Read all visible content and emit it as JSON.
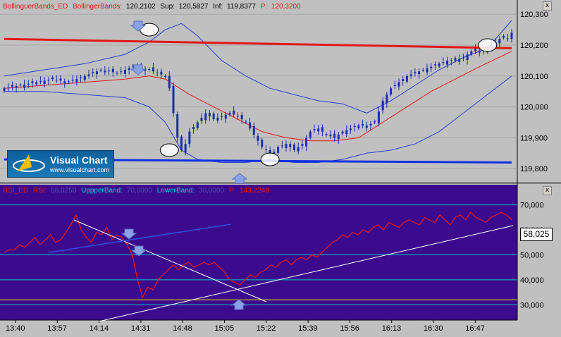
{
  "colors": {
    "price_bg": "#c0c0c0",
    "rsi_bg": "#3c0a8c",
    "candles": "#1a2ea8",
    "upper_band": "#2a3fd0",
    "mid_band": "#e01818",
    "support": "#e01818",
    "inferior": "#1030e0",
    "rsi_line": "#e01818",
    "rsi_levels": "#00c8c8",
    "rsi_band": "#e8e800",
    "trend_lines": "#ffffff"
  },
  "header": {
    "name": "BollinguerBands_ED",
    "band_label": "BollingerBands:",
    "band_value": "120,2102",
    "sup_label": "Sup:",
    "sup_value": "120,5827",
    "inf_label": "Inf:",
    "inf_value": "119,8377",
    "p_label": "P:",
    "p_value": "120,3200"
  },
  "rsi_header": {
    "name": "RSI_ED",
    "rsi_label": "RSI:",
    "rsi_value": "58,0250",
    "upper_label": "UppperBand:",
    "upper_value": "70,0000",
    "lower_label": "LowerBand:",
    "lower_value": "30,0000",
    "p_label": "P:",
    "p_value": "143,2248"
  },
  "logo": {
    "title": "Visual Chart",
    "url": "www.visualchart.com"
  },
  "buttons": {
    "close": "x"
  },
  "rsi_current_label": "58,025",
  "chart_data": [
    {
      "type": "candlestick",
      "panel": "price",
      "y_ticks": [
        "120,300",
        "120,200",
        "120,100",
        "120,000",
        "119,900",
        "119,800"
      ],
      "ylim": [
        119.78,
        120.305
      ],
      "x_ticks": [
        "13:40",
        "13:57",
        "14:14",
        "14:31",
        "14:48",
        "15:05",
        "15:22",
        "15:39",
        "15:56",
        "16:13",
        "16:30",
        "16:47"
      ],
      "close_series": [
        [
          0,
          120.06
        ],
        [
          4,
          120.07
        ],
        [
          8,
          120.08
        ],
        [
          12,
          120.09
        ],
        [
          16,
          120.08
        ],
        [
          20,
          120.1
        ],
        [
          24,
          120.12
        ],
        [
          28,
          120.11
        ],
        [
          32,
          120.13
        ],
        [
          36,
          120.12
        ],
        [
          40,
          120.1
        ],
        [
          41,
          120.06
        ],
        [
          42,
          119.98
        ],
        [
          43,
          119.9
        ],
        [
          44,
          119.86
        ],
        [
          45,
          119.88
        ],
        [
          46,
          119.92
        ],
        [
          48,
          119.95
        ],
        [
          50,
          119.98
        ],
        [
          52,
          119.96
        ],
        [
          54,
          119.97
        ],
        [
          56,
          119.98
        ],
        [
          58,
          119.97
        ],
        [
          60,
          119.95
        ],
        [
          62,
          119.91
        ],
        [
          64,
          119.87
        ],
        [
          65,
          119.86
        ],
        [
          66,
          119.84
        ],
        [
          68,
          119.87
        ],
        [
          70,
          119.88
        ],
        [
          72,
          119.86
        ],
        [
          74,
          119.88
        ],
        [
          76,
          119.92
        ],
        [
          78,
          119.93
        ],
        [
          80,
          119.91
        ],
        [
          82,
          119.9
        ],
        [
          84,
          119.92
        ],
        [
          86,
          119.93
        ],
        [
          88,
          119.94
        ],
        [
          90,
          119.94
        ],
        [
          92,
          119.95
        ],
        [
          94,
          120.02
        ],
        [
          96,
          120.06
        ],
        [
          98,
          120.08
        ],
        [
          100,
          120.1
        ],
        [
          102,
          120.11
        ],
        [
          104,
          120.12
        ],
        [
          106,
          120.13
        ],
        [
          108,
          120.14
        ],
        [
          110,
          120.15
        ],
        [
          112,
          120.15
        ],
        [
          114,
          120.16
        ],
        [
          116,
          120.18
        ],
        [
          118,
          120.18
        ],
        [
          120,
          120.19
        ],
        [
          122,
          120.21
        ],
        [
          124,
          120.23
        ],
        [
          125,
          120.22
        ],
        [
          126,
          120.24
        ]
      ],
      "series": [
        {
          "name": "Sup",
          "points": [
            [
              0,
              120.1
            ],
            [
              10,
              120.12
            ],
            [
              20,
              120.14
            ],
            [
              30,
              120.17
            ],
            [
              36,
              120.21
            ],
            [
              40,
              120.25
            ],
            [
              44,
              120.27
            ],
            [
              48,
              120.23
            ],
            [
              54,
              120.15
            ],
            [
              60,
              120.1
            ],
            [
              66,
              120.06
            ],
            [
              72,
              120.04
            ],
            [
              78,
              120.02
            ],
            [
              84,
              120.01
            ],
            [
              90,
              119.98
            ],
            [
              96,
              120.02
            ],
            [
              102,
              120.07
            ],
            [
              108,
              120.12
            ],
            [
              114,
              120.16
            ],
            [
              120,
              120.19
            ],
            [
              126,
              120.28
            ]
          ]
        },
        {
          "name": "BollingerBands",
          "points": [
            [
              0,
              120.06
            ],
            [
              10,
              120.07
            ],
            [
              20,
              120.08
            ],
            [
              30,
              120.09
            ],
            [
              36,
              120.1
            ],
            [
              40,
              120.09
            ],
            [
              46,
              120.04
            ],
            [
              52,
              120.0
            ],
            [
              58,
              119.96
            ],
            [
              64,
              119.92
            ],
            [
              70,
              119.9
            ],
            [
              76,
              119.89
            ],
            [
              82,
              119.89
            ],
            [
              88,
              119.9
            ],
            [
              94,
              119.95
            ],
            [
              100,
              120.0
            ],
            [
              106,
              120.05
            ],
            [
              112,
              120.09
            ],
            [
              118,
              120.13
            ],
            [
              126,
              120.18
            ]
          ]
        },
        {
          "name": "Inf",
          "points": [
            [
              0,
              120.05
            ],
            [
              10,
              120.05
            ],
            [
              20,
              120.04
            ],
            [
              30,
              120.03
            ],
            [
              36,
              120.0
            ],
            [
              40,
              119.95
            ],
            [
              44,
              119.86
            ],
            [
              48,
              119.83
            ],
            [
              54,
              119.82
            ],
            [
              60,
              119.82
            ],
            [
              66,
              119.83
            ],
            [
              72,
              119.82
            ],
            [
              78,
              119.82
            ],
            [
              84,
              119.83
            ],
            [
              90,
              119.85
            ],
            [
              96,
              119.86
            ],
            [
              102,
              119.88
            ],
            [
              108,
              119.92
            ],
            [
              114,
              119.98
            ],
            [
              120,
              120.04
            ],
            [
              126,
              120.1
            ]
          ]
        }
      ],
      "horizontal_lines": [
        {
          "name": "Support",
          "points": [
            [
              0,
              120.22
            ],
            [
              126,
              120.19
            ]
          ]
        },
        {
          "name": "Low",
          "points": [
            [
              0,
              119.83
            ],
            [
              126,
              119.82
            ]
          ]
        }
      ]
    },
    {
      "type": "line",
      "panel": "rsi",
      "y_ticks": [
        "70,000",
        "60,000",
        "50,000",
        "40,000",
        "30,000"
      ],
      "ylim": [
        25,
        73
      ],
      "levels": [
        70,
        50,
        30
      ],
      "bands": [
        32
      ],
      "series": [
        {
          "name": "RSI",
          "values": [
            51,
            52,
            52,
            54,
            53,
            55,
            57,
            54,
            56,
            58,
            55,
            56,
            59,
            62,
            66,
            60,
            57,
            55,
            59,
            58,
            61,
            56,
            58,
            57,
            54,
            50,
            40,
            33,
            37,
            36,
            40,
            42,
            44,
            46,
            44,
            46,
            47,
            45,
            46,
            47,
            46,
            47,
            45,
            43,
            40,
            39,
            38,
            40,
            42,
            41,
            43,
            44,
            46,
            45,
            47,
            48,
            46,
            48,
            49,
            48,
            50,
            49,
            51,
            53,
            55,
            56,
            58,
            57,
            59,
            58,
            60,
            59,
            61,
            62,
            60,
            63,
            62,
            61,
            63,
            64,
            63,
            62,
            65,
            64,
            63,
            66,
            64,
            62,
            65,
            66,
            64,
            67,
            65,
            64,
            63,
            65,
            66,
            67,
            66,
            64
          ]
        }
      ]
    }
  ]
}
